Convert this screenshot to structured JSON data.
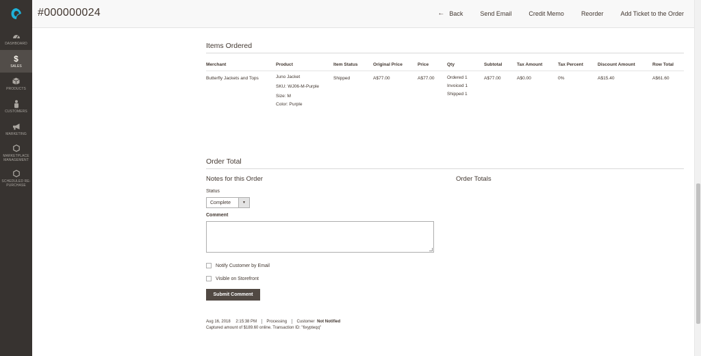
{
  "sidebar": {
    "logo_icon": "magento-logo-icon",
    "items": [
      {
        "label": "DASHBOARD",
        "icon": "dashboard-icon"
      },
      {
        "label": "SALES",
        "icon": "dollar-icon",
        "active": true
      },
      {
        "label": "PRODUCTS",
        "icon": "box-icon"
      },
      {
        "label": "CUSTOMERS",
        "icon": "person-icon"
      },
      {
        "label": "MARKETING",
        "icon": "megaphone-icon"
      },
      {
        "label": "MARKETPLACE MANAGEMENT",
        "icon": "hexagon-icon"
      },
      {
        "label": "SCHEDULED RE-PURCHASE",
        "icon": "hexagon-icon"
      }
    ]
  },
  "header": {
    "title": "#000000024",
    "actions": {
      "back": "Back",
      "send_email": "Send Email",
      "credit_memo": "Credit Memo",
      "reorder": "Reorder",
      "add_ticket": "Add Ticket to the Order"
    }
  },
  "items_ordered": {
    "title": "Items Ordered",
    "columns": [
      "Merchant",
      "Product",
      "Item Status",
      "Original Price",
      "Price",
      "Qty",
      "Subtotal",
      "Tax Amount",
      "Tax Percent",
      "Discount Amount",
      "Row Total"
    ],
    "row": {
      "merchant": "Butterfly Jackets and Tops",
      "product_name": "Juno Jacket",
      "sku": "SKU: WJ06-M-Purple",
      "size": "Size: M",
      "color": "Color: Purple",
      "item_status": "Shipped",
      "original_price": "A$77.00",
      "price": "A$77.00",
      "qty_ordered": "Ordered 1",
      "qty_invoiced": "Invoiced 1",
      "qty_shipped": "Shipped 1",
      "subtotal": "A$77.00",
      "tax_amount": "A$0.00",
      "tax_percent": "0%",
      "discount_amount": "A$15.40",
      "row_total": "A$61.60"
    }
  },
  "order_total": {
    "title": "Order Total",
    "notes_title": "Notes for this Order",
    "totals_title": "Order Totals",
    "status_label": "Status",
    "status_value": "Complete",
    "comment_label": "Comment",
    "notify_label": "Notify Customer by Email",
    "visible_label": "Visible on Storefront",
    "submit_label": "Submit Comment"
  },
  "history": {
    "date": "Aug 16, 2018",
    "time": "2:15:38 PM",
    "status": "Processing",
    "customer_label": "Customer",
    "customer_value": "Not Notified",
    "message": "Captured amount of $189.60 online. Transaction ID: \"6xypteqq\""
  },
  "colors": {
    "sidebar_bg": "#373330",
    "sidebar_active": "#524d49",
    "button_bg": "#514943",
    "logo_accent": "#1fb1d8"
  }
}
